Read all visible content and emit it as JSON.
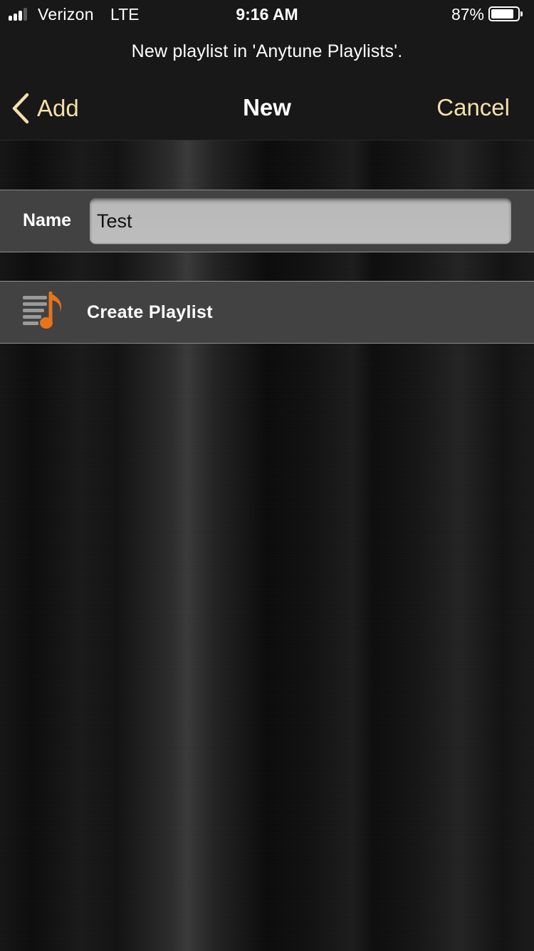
{
  "status_bar": {
    "carrier": "Verizon",
    "network": "LTE",
    "time": "9:16 AM",
    "battery_text": "87%",
    "battery_level": 0.87,
    "signal_bars_active": 3,
    "signal_bars_total": 4
  },
  "prompt": {
    "text": "New playlist in 'Anytune Playlists'."
  },
  "nav": {
    "back_label": "Add",
    "title": "New",
    "cancel_label": "Cancel",
    "back_icon": "chevron-left-icon"
  },
  "form": {
    "name_label": "Name",
    "name_value": "Test"
  },
  "actions": {
    "create_label": "Create Playlist",
    "create_icon": "playlist-music-icon"
  },
  "colors": {
    "accent": "#f5dfa9",
    "icon_orange": "#e8731a",
    "icon_gray": "#9a9a9a",
    "row_background": "#424242"
  }
}
